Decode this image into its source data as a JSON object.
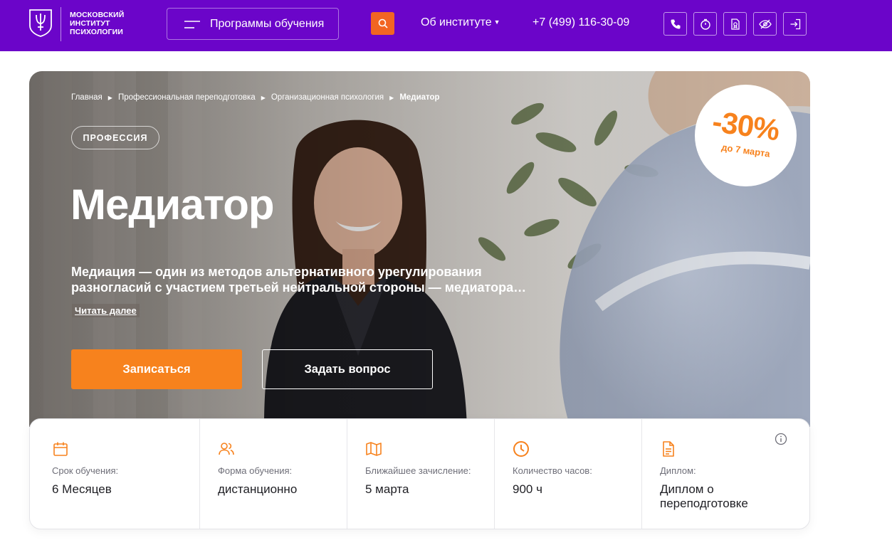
{
  "header": {
    "logo_lines": [
      "МОСКОВСКИЙ",
      "ИНСТИТУТ",
      "ПСИХОЛОГИИ"
    ],
    "programs_label": "Программы обучения",
    "about_label": "Об институте",
    "phone": "+7 (499) 116-30-09",
    "icons": [
      "phone-icon",
      "clock-icon",
      "document-icon",
      "accessibility-eye-icon",
      "login-icon"
    ],
    "brand_color": "#6b05c9",
    "search_color": "#f26522"
  },
  "hero": {
    "breadcrumb": [
      "Главная",
      "Профессиональная переподготовка",
      "Организационная психология",
      "Медиатор"
    ],
    "tag": "ПРОФЕССИЯ",
    "title": "Медиатор",
    "description": "Медиация — один из методов альтернативного урегулирования разногласий с участием третьей нейтральной стороны — медиатора…",
    "read_more": "Читать далее",
    "enroll_label": "Записаться",
    "ask_label": "Задать вопрос",
    "discount": {
      "percent": "-30%",
      "until": "до 7 марта"
    },
    "accent_color": "#f7821d"
  },
  "info": {
    "items": [
      {
        "icon": "calendar-icon",
        "label": "Срок обучения:",
        "value": "6 Месяцев"
      },
      {
        "icon": "users-icon",
        "label": "Форма обучения:",
        "value": "дистанционно"
      },
      {
        "icon": "map-icon",
        "label": "Ближайшее зачисление:",
        "value": "5 марта"
      },
      {
        "icon": "clock-icon",
        "label": "Количество часов:",
        "value": "900 ч"
      },
      {
        "icon": "diploma-icon",
        "label": "Диплом:",
        "value": "Диплом о переподготовке"
      }
    ],
    "info_icon": "info-icon"
  }
}
